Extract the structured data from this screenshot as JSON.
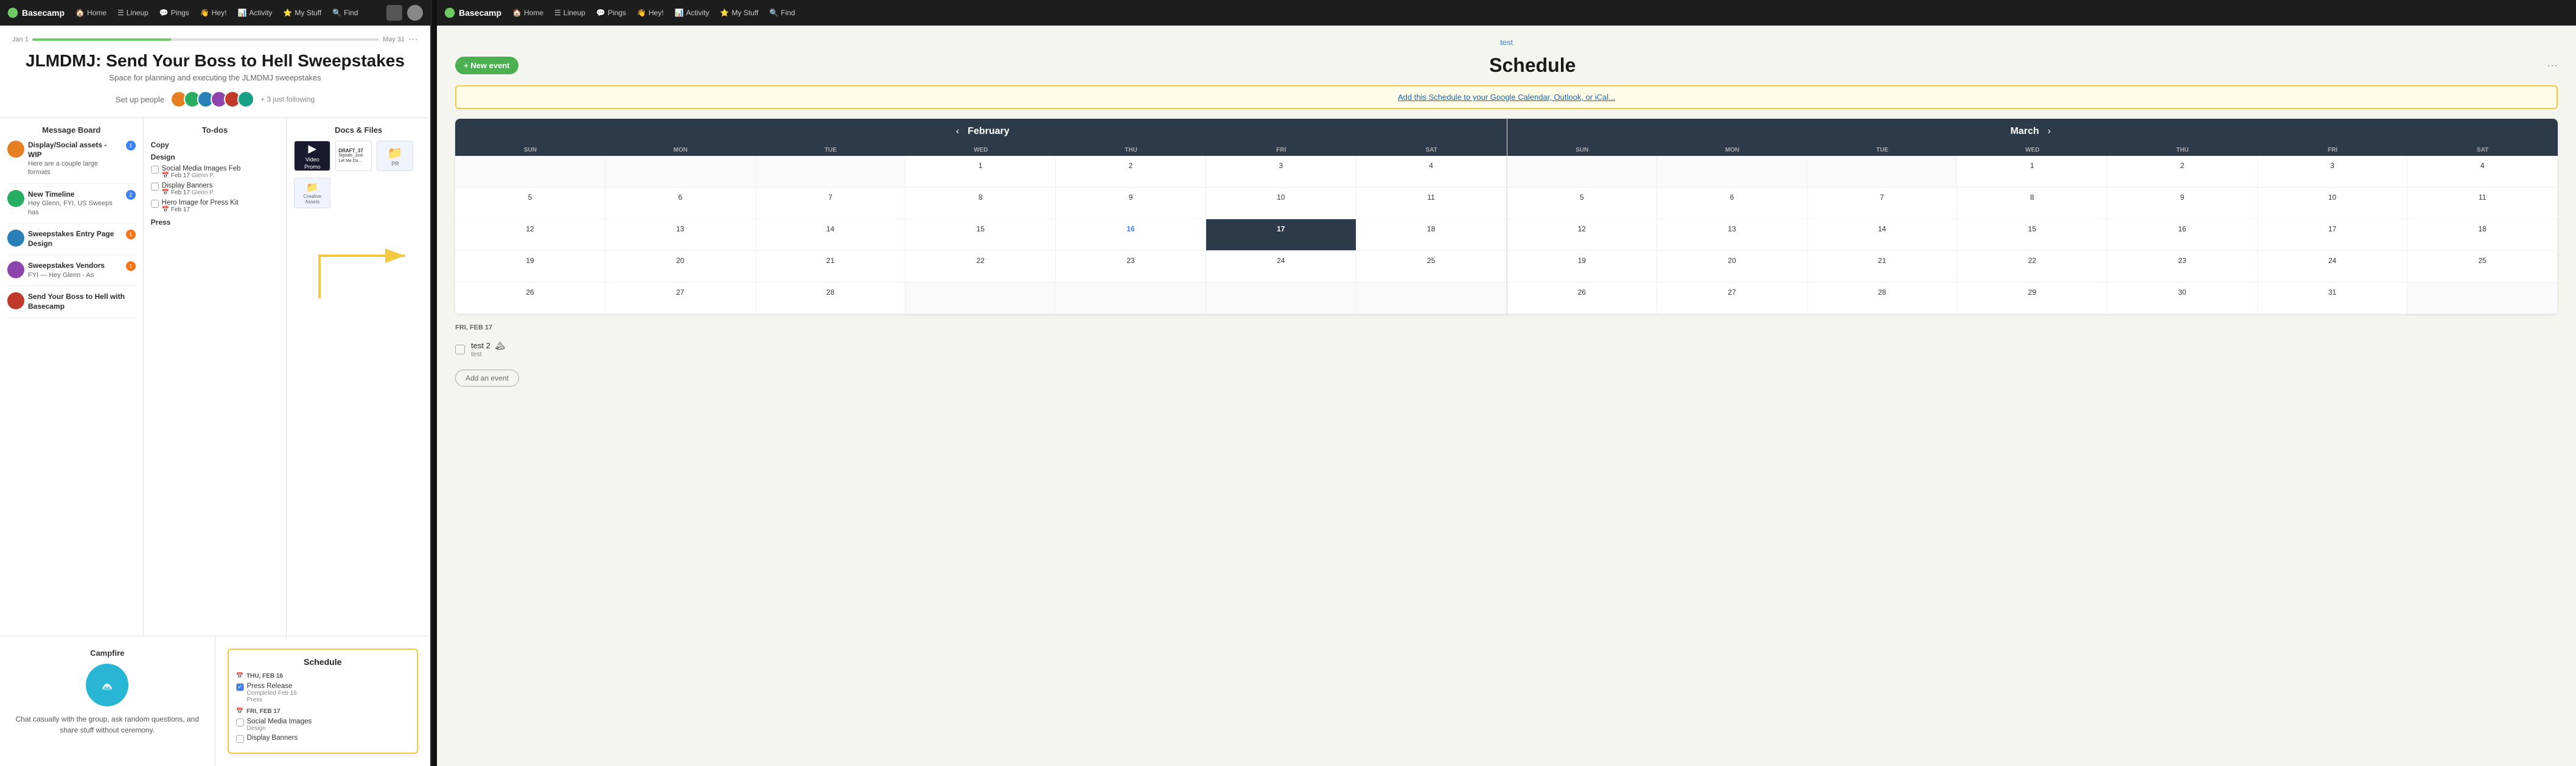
{
  "left_nav": {
    "logo": "Basecamp",
    "items": [
      {
        "label": "Home",
        "icon": "home-icon"
      },
      {
        "label": "Lineup",
        "icon": "lineup-icon"
      },
      {
        "label": "Pings",
        "icon": "pings-icon"
      },
      {
        "label": "Hey!",
        "icon": "hey-icon"
      },
      {
        "label": "Activity",
        "icon": "activity-icon"
      },
      {
        "label": "My Stuff",
        "icon": "mystuff-icon"
      },
      {
        "label": "Find",
        "icon": "find-icon"
      }
    ]
  },
  "right_nav": {
    "logo": "Basecamp",
    "items": [
      {
        "label": "Home",
        "icon": "home-icon"
      },
      {
        "label": "Lineup",
        "icon": "lineup-icon"
      },
      {
        "label": "Pings",
        "icon": "pings-icon"
      },
      {
        "label": "Hey!",
        "icon": "hey-icon"
      },
      {
        "label": "Activity",
        "icon": "activity-icon"
      },
      {
        "label": "My Stuff",
        "icon": "mystuff-icon"
      },
      {
        "label": "Find",
        "icon": "find-icon"
      }
    ]
  },
  "project": {
    "date_start": "Jan 1",
    "date_end": "May 31",
    "title": "JLMDMJ: Send Your Boss to Hell Sweepstakes",
    "subtitle": "Space for planning and executing the JLMDMJ sweepstakes",
    "set_people_label": "Set up people",
    "following_text": "+ 3 just following",
    "avatars": [
      {
        "color": "av1"
      },
      {
        "color": "av2"
      },
      {
        "color": "av3"
      },
      {
        "color": "av4"
      },
      {
        "color": "av5"
      },
      {
        "color": "av6"
      }
    ]
  },
  "message_board": {
    "title": "Message Board",
    "messages": [
      {
        "title": "Display/Social assets - WIP",
        "body": "Here are a couple large formats",
        "badge": 1,
        "badge_color": "blue"
      },
      {
        "title": "New Timeline",
        "body": "Hey Glenn, FYI, US Sweeps has",
        "badge": 2,
        "badge_color": "blue"
      },
      {
        "title": "Sweepstakes Entry Page Design",
        "body": "",
        "badge": 1,
        "badge_color": "orange"
      },
      {
        "title": "Sweepstakes Vendors",
        "body": "FYI — Hey Glenn - As",
        "badge": 1,
        "badge_color": "orange"
      },
      {
        "title": "Send Your Boss to Hell with Basecamp",
        "body": "",
        "badge": null
      }
    ]
  },
  "todos": {
    "title": "To-dos",
    "groups": [
      {
        "name": "Copy",
        "items": []
      },
      {
        "name": "Design",
        "items": [
          {
            "label": "Social Media Images Feb",
            "date": "Feb 17",
            "assignee": "Glenn P."
          },
          {
            "label": "Display Banners",
            "date": "Feb 17",
            "assignee": "Glenn P."
          },
          {
            "label": "Hero Image for Press Kit",
            "date": "Feb 17",
            "assignee": ""
          }
        ]
      },
      {
        "name": "Press",
        "items": []
      }
    ]
  },
  "docs": {
    "title": "Docs & Files",
    "items": [
      {
        "name": "Video Promo",
        "type": "video"
      },
      {
        "name": "DRAFT_37 Signals_Just Let Me Do...",
        "type": "doc"
      },
      {
        "name": "PR",
        "type": "folder"
      },
      {
        "name": "Creative Assets",
        "type": "folder"
      }
    ]
  },
  "campfire": {
    "title": "Campfire",
    "description": "Chat casually with the group, ask random questions, and share stuff without ceremony."
  },
  "schedule_card": {
    "title": "Schedule",
    "events": [
      {
        "date_label": "THU, FEB 16",
        "items": [
          {
            "label": "Press Release",
            "checked": true,
            "sub": "Completed Feb 16",
            "tag": "Press"
          }
        ]
      },
      {
        "date_label": "FRI, FEB 17",
        "items": [
          {
            "label": "Social Media Images",
            "checked": false,
            "tag": "Design"
          },
          {
            "label": "Display Banners",
            "checked": false,
            "tag": ""
          }
        ]
      }
    ]
  },
  "right_panel": {
    "breadcrumb": "test",
    "schedule_title": "Schedule",
    "new_event_label": "+ New event",
    "google_cal_text": "Add this Schedule to your Google Calendar, Outlook, or iCal...",
    "months": [
      {
        "name": "February",
        "year": "",
        "weekdays": [
          "SUN",
          "MON",
          "TUE",
          "WED",
          "THU",
          "FRI",
          "SAT"
        ],
        "weeks": [
          [
            null,
            null,
            null,
            1,
            2,
            3,
            4
          ],
          [
            5,
            6,
            7,
            8,
            9,
            10,
            11
          ],
          [
            12,
            13,
            14,
            15,
            16,
            17,
            18
          ],
          [
            19,
            20,
            21,
            22,
            23,
            24,
            25
          ],
          [
            26,
            27,
            28,
            null,
            null,
            null,
            null
          ]
        ],
        "today": 17,
        "highlighted": 16
      },
      {
        "name": "March",
        "year": "",
        "weekdays": [
          "SUN",
          "MON",
          "TUE",
          "WED",
          "THU",
          "FRI",
          "SAT"
        ],
        "weeks": [
          [
            null,
            null,
            null,
            1,
            2,
            3,
            4
          ],
          [
            5,
            6,
            7,
            8,
            9,
            10,
            11
          ],
          [
            12,
            13,
            14,
            15,
            16,
            17,
            18
          ],
          [
            19,
            20,
            21,
            22,
            23,
            24,
            25
          ],
          [
            26,
            27,
            28,
            29,
            30,
            31,
            null
          ]
        ],
        "today": null,
        "highlighted": null
      }
    ],
    "event_section": {
      "date_label": "FRI, FEB 17",
      "events": [
        {
          "label": "test 2",
          "sub": "test",
          "has_person": true
        }
      ],
      "add_event_label": "Add an event"
    }
  }
}
